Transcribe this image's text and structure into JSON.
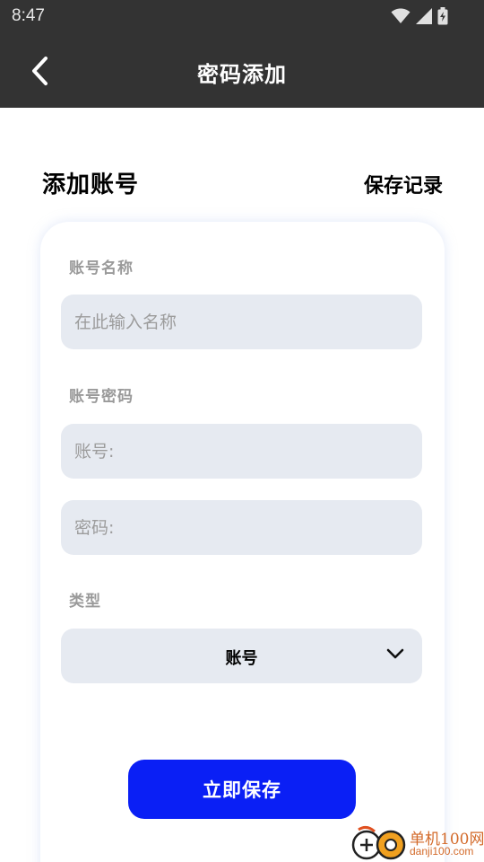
{
  "status_bar": {
    "time": "8:47",
    "icons": [
      "wifi-icon",
      "signal-icon",
      "battery-icon"
    ]
  },
  "app_bar": {
    "title": "密码添加",
    "back_icon": "chevron-left-icon"
  },
  "header": {
    "title": "添加账号",
    "records_link": "保存记录"
  },
  "form": {
    "name_label": "账号名称",
    "name_placeholder": "在此输入名称",
    "credential_label": "账号密码",
    "account_placeholder": "账号:",
    "password_placeholder": "密码:",
    "type_label": "类型",
    "type_value": "账号",
    "type_icon": "chevron-down-icon",
    "save_label": "立即保存"
  },
  "watermark": {
    "name": "单机100网",
    "url": "danji100.com"
  },
  "colors": {
    "bar_background": "#333333",
    "input_background": "#e6eaf1",
    "primary_button": "#0a1ff5",
    "label_gray": "#9a9a9a",
    "watermark_orange": "#d36a2a"
  }
}
